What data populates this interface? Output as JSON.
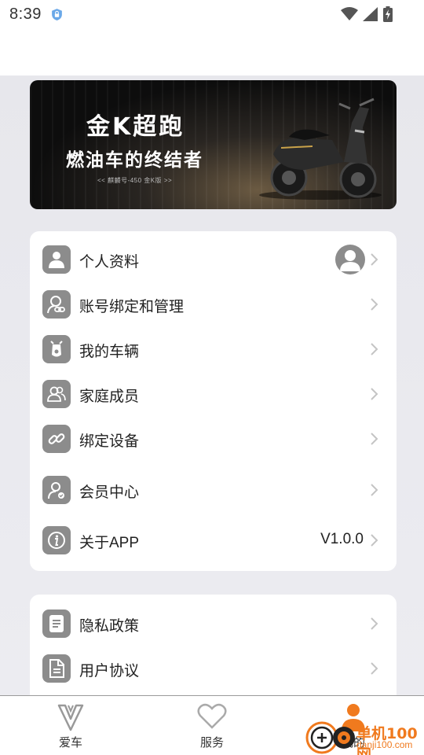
{
  "status_bar": {
    "time": "8:39"
  },
  "banner": {
    "title": "金K超跑",
    "subtitle": "燃油车的终结者",
    "tagline": "<< 麒麟号-450  金K版 >>"
  },
  "menu_main": [
    {
      "label": "个人资料",
      "icon": "user-icon",
      "has_avatar": true
    },
    {
      "label": "账号绑定和管理",
      "icon": "account-link-icon"
    },
    {
      "label": "我的车辆",
      "icon": "scooter-icon"
    },
    {
      "label": "家庭成员",
      "icon": "family-icon"
    },
    {
      "label": "绑定设备",
      "icon": "link-icon"
    },
    {
      "label": "会员中心",
      "icon": "member-icon"
    },
    {
      "label": "关于APP",
      "icon": "info-icon",
      "value": "V1.0.0"
    }
  ],
  "menu_secondary": [
    {
      "label": "隐私政策",
      "icon": "document-icon"
    },
    {
      "label": "用户协议",
      "icon": "agreement-icon"
    }
  ],
  "bottom_nav": {
    "items": [
      {
        "label": "爱车",
        "icon": "car-logo-icon"
      },
      {
        "label": "服务",
        "icon": "heart-icon"
      },
      {
        "label": "我的",
        "icon": "profile-icon",
        "active": true
      }
    ]
  },
  "watermark": {
    "line1": "单机100网",
    "line2": "danji100.com"
  },
  "colors": {
    "icon_bg": "#8c8c8c",
    "active": "#f07a1e",
    "page_bg": "#e9e9ee"
  }
}
